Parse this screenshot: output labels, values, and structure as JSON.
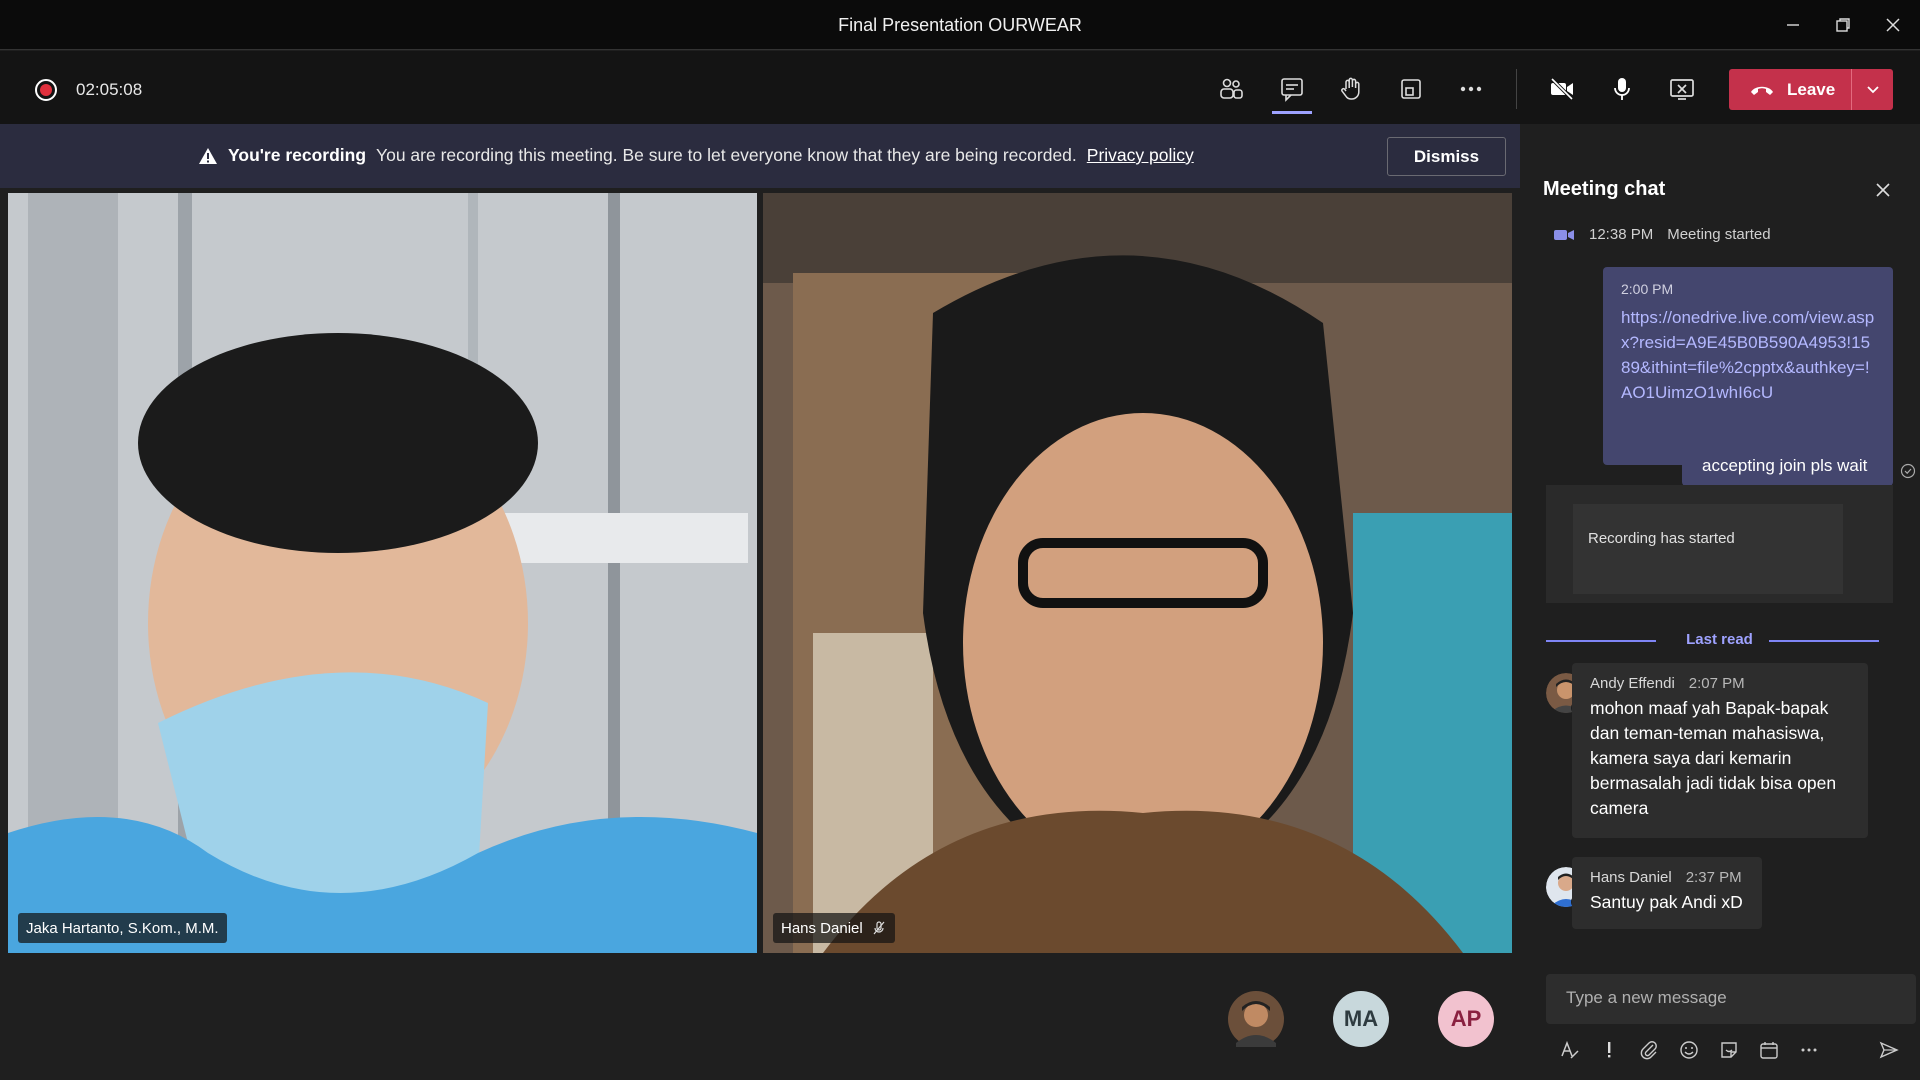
{
  "window": {
    "title": "Final Presentation OURWEAR"
  },
  "toolbar": {
    "timer": "02:05:08",
    "leave_label": "Leave"
  },
  "banner": {
    "title": "You're recording",
    "text": "You are recording this meeting. Be sure to let everyone know that they are being recorded.",
    "link": "Privacy policy",
    "dismiss_label": "Dismiss"
  },
  "videos": [
    {
      "name": "Jaka Hartanto, S.Kom., M.M."
    },
    {
      "name": "Hans Daniel"
    }
  ],
  "participants": [
    {
      "initials": "",
      "color": "#6b4f3a"
    },
    {
      "initials": "MA",
      "color": "#c8d8dc",
      "text_color": "#2e3b40"
    },
    {
      "initials": "AP",
      "color": "#f2c2cf",
      "text_color": "#8a2040"
    }
  ],
  "chat": {
    "title": "Meeting chat",
    "meeting_started_time": "12:38 PM",
    "meeting_started_text": "Meeting started",
    "self_link_time": "2:00 PM",
    "self_link": "https://onedrive.live.com/view.aspx?resid=A9E45B0B590A4953!1589&ithint=file%2cpptx&authkey=!AO1UimzO1whI6cU",
    "self_short": "accepting join pls wait",
    "recording_notice": "Recording has started",
    "last_read": "Last read",
    "messages": [
      {
        "author": "Andy Effendi",
        "time": "2:07 PM",
        "text": "mohon maaf yah Bapak-bapak dan teman-teman mahasiswa, kamera saya dari kemarin bermasalah jadi tidak bisa open camera"
      },
      {
        "author": "Hans Daniel",
        "time": "2:37 PM",
        "text": "Santuy pak Andi xD"
      }
    ],
    "compose_placeholder": "Type a new message"
  },
  "colors": {
    "accent": "#7f85f5",
    "leave": "#c4314b",
    "recording": "#e0303d",
    "banner": "#2b2c3f"
  }
}
